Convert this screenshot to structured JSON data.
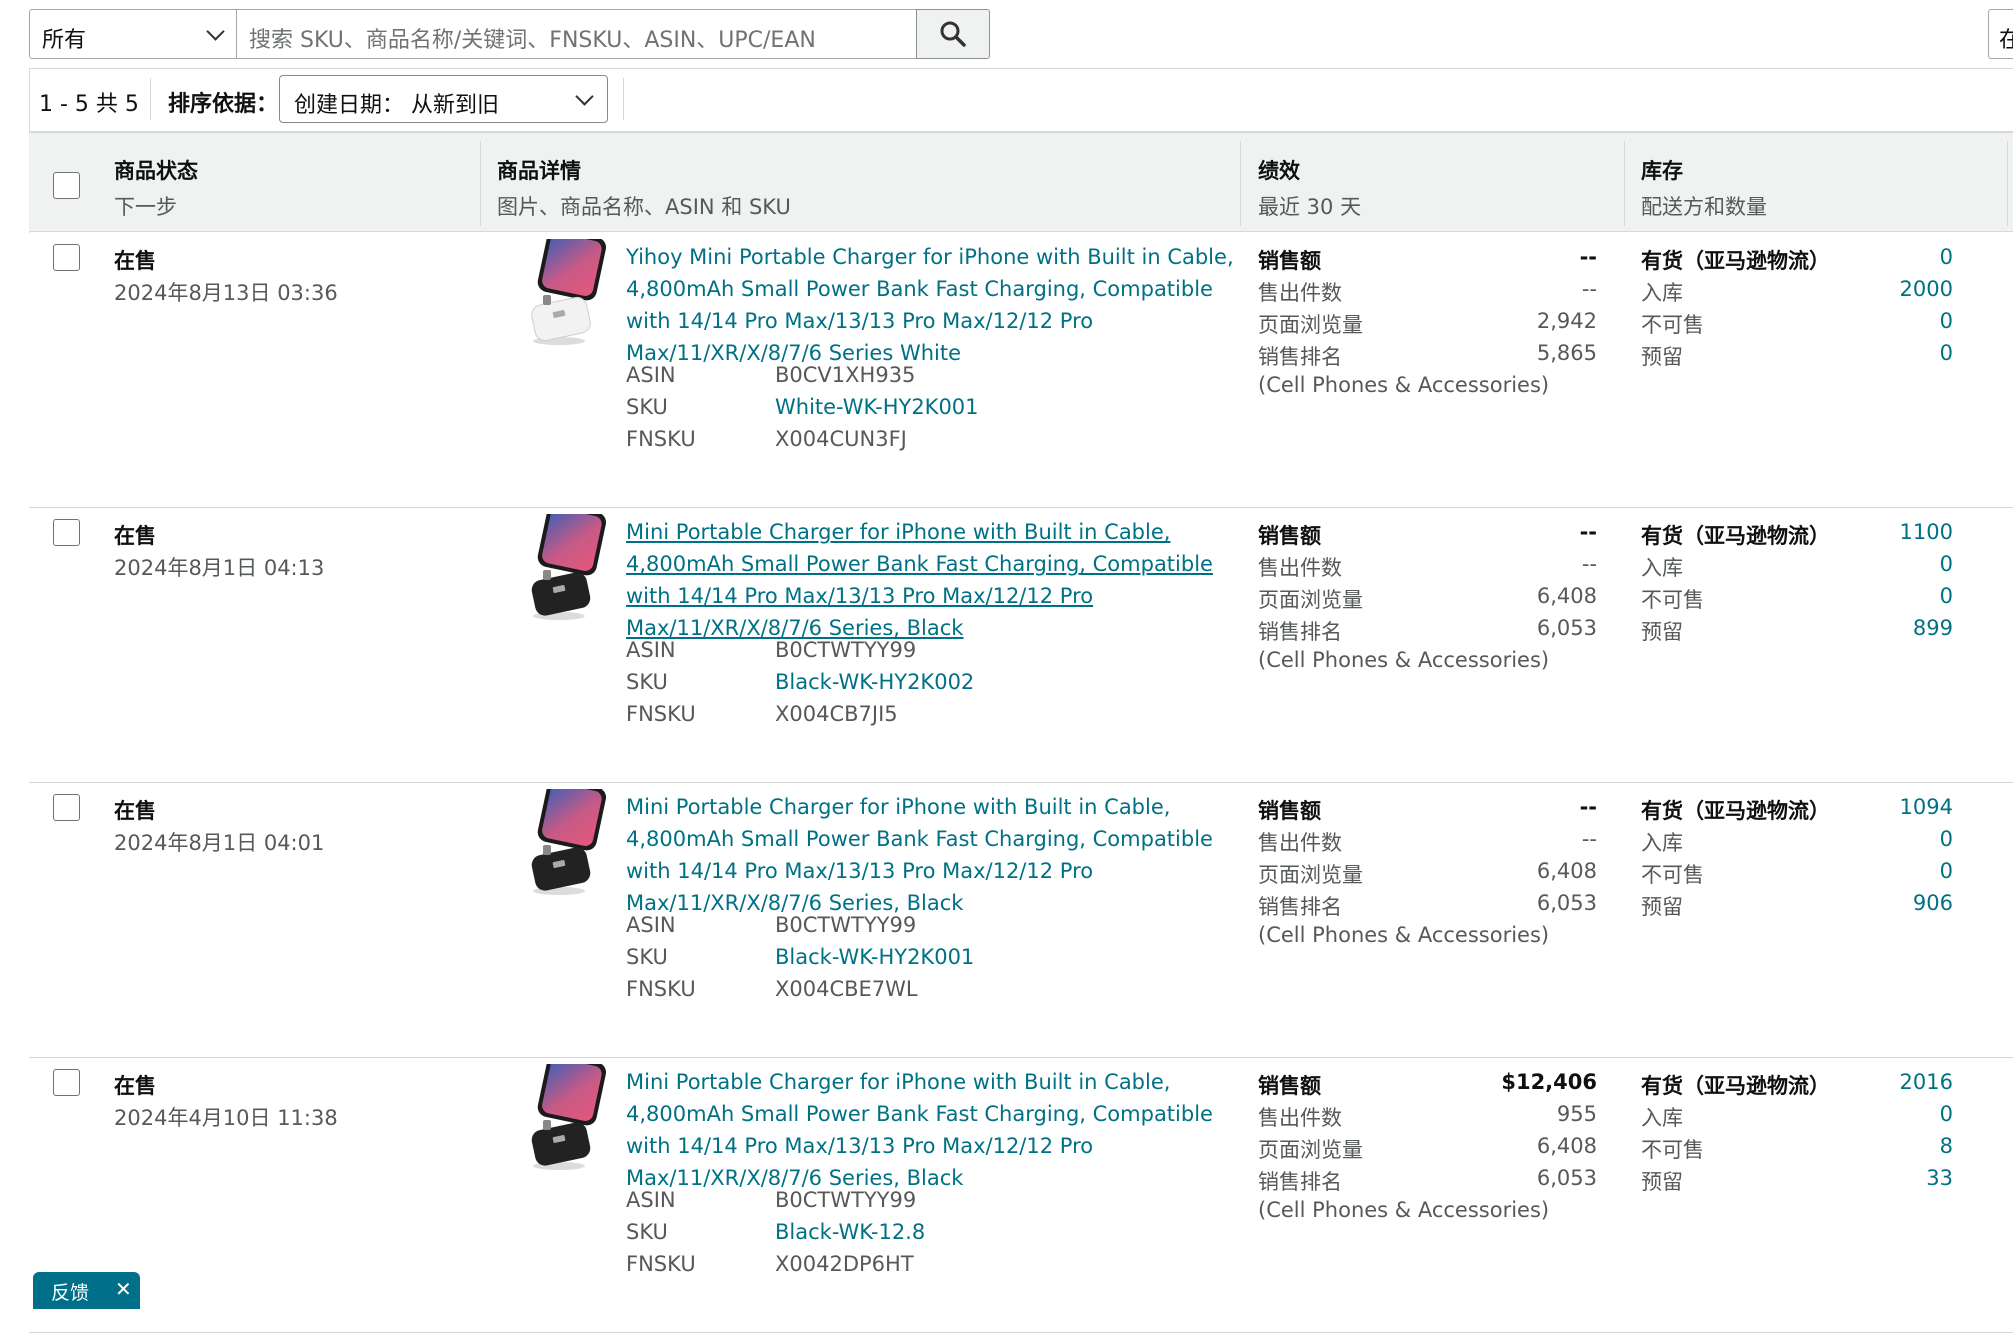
{
  "search": {
    "filter_value": "所有",
    "placeholder": "搜索 SKU、商品名称/关键词、FNSKU、ASIN、UPC/EAN",
    "right_clipped_text": "在"
  },
  "toolbar": {
    "count_text": "1 - 5 共 5",
    "sort_label": "排序依据：",
    "sort_value": "创建日期：  从新到旧"
  },
  "table_header": {
    "status_title": "商品状态",
    "status_sub": "下一步",
    "details_title": "商品详情",
    "details_sub": "图片、商品名称、ASIN 和 SKU",
    "perf_title": "绩效",
    "perf_sub": "最近 30 天",
    "inv_title": "库存",
    "inv_sub": "配送方和数量"
  },
  "labels": {
    "asin": "ASIN",
    "sku": "SKU",
    "fnsku": "FNSKU",
    "sales": "销售额",
    "units": "售出件数",
    "views": "页面浏览量",
    "rank": "销售排名",
    "category": "(Cell Phones & Accessories)",
    "fulfillment": "有货（亚马逊物流）",
    "inbound": "入库",
    "unfulfillable": "不可售",
    "reserved": "预留"
  },
  "rows": [
    {
      "status": "在售",
      "date": "2024年8月13日 03:36",
      "title": "Yihoy Mini Portable Charger for iPhone with Built in Cable, 4,800mAh Small Power Bank Fast Charging, Compatible with 14/14 Pro Max/13/13 Pro Max/12/12 Pro Max/11/XR/X/8/7/6 Series White",
      "asin": "B0CV1XH935",
      "sku": "White-WK-HY2K001",
      "fnsku": "X004CUN3FJ",
      "sales": "--",
      "units": "--",
      "views": "2,942",
      "rank": "5,865",
      "available": "0",
      "inbound": "2000",
      "unfulfillable": "0",
      "reserved": "0",
      "device_color": "white"
    },
    {
      "status": "在售",
      "date": "2024年8月1日 04:13",
      "title": "Mini Portable Charger for iPhone with Built in Cable, 4,800mAh Small Power Bank Fast Charging, Compatible with 14/14 Pro Max/13/13 Pro Max/12/12 Pro Max/11/XR/X/8/7/6 Series, Black",
      "asin": "B0CTWTYY99",
      "sku": "Black-WK-HY2K002",
      "fnsku": "X004CB7JI5",
      "sales": "--",
      "units": "--",
      "views": "6,408",
      "rank": "6,053",
      "available": "1100",
      "inbound": "0",
      "unfulfillable": "0",
      "reserved": "899",
      "device_color": "black"
    },
    {
      "status": "在售",
      "date": "2024年8月1日 04:01",
      "title": "Mini Portable Charger for iPhone with Built in Cable, 4,800mAh Small Power Bank Fast Charging, Compatible with 14/14 Pro Max/13/13 Pro Max/12/12 Pro Max/11/XR/X/8/7/6 Series, Black",
      "asin": "B0CTWTYY99",
      "sku": "Black-WK-HY2K001",
      "fnsku": "X004CBE7WL",
      "sales": "--",
      "units": "--",
      "views": "6,408",
      "rank": "6,053",
      "available": "1094",
      "inbound": "0",
      "unfulfillable": "0",
      "reserved": "906",
      "device_color": "black"
    },
    {
      "status": "在售",
      "date": "2024年4月10日 11:38",
      "title": "Mini Portable Charger for iPhone with Built in Cable, 4,800mAh Small Power Bank Fast Charging, Compatible with 14/14 Pro Max/13/13 Pro Max/12/12 Pro Max/11/XR/X/8/7/6 Series, Black",
      "asin": "B0CTWTYY99",
      "sku": "Black-WK-12.8",
      "fnsku": "X0042DP6HT",
      "sales": "$12,406",
      "units": "955",
      "views": "6,408",
      "rank": "6,053",
      "available": "2016",
      "inbound": "0",
      "unfulfillable": "8",
      "reserved": "33",
      "device_color": "black"
    }
  ],
  "feedback": {
    "label": "反馈",
    "close": "✕"
  },
  "colors": {
    "link": "#007185",
    "header_bg": "#f0f2f2",
    "feedback_bg": "#00708a"
  }
}
